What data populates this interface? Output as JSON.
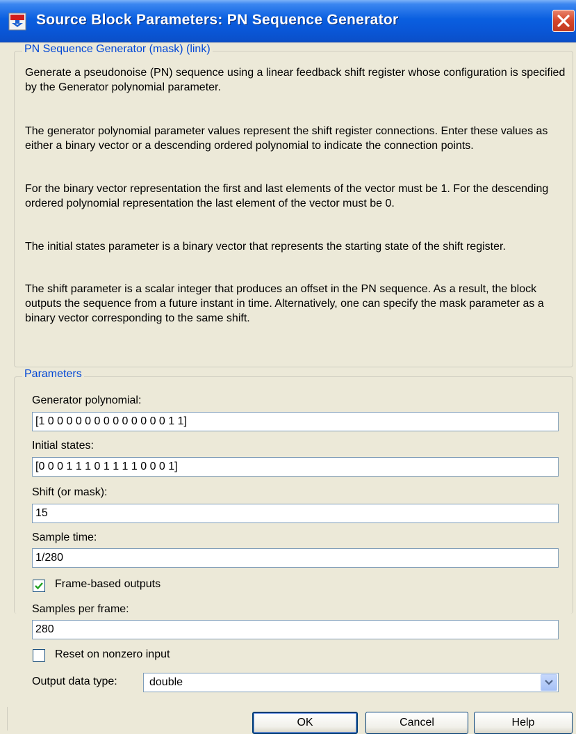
{
  "window": {
    "title": "Source Block Parameters: PN Sequence Generator",
    "app_icon": "simulink-block-icon",
    "close_icon": "close-icon"
  },
  "description": {
    "legend": "PN Sequence Generator (mask) (link)",
    "paragraphs": [
      "Generate a pseudonoise (PN) sequence using a linear feedback shift register whose configuration is specified by the Generator polynomial parameter.",
      "The generator polynomial parameter values represent the shift register connections. Enter these values as either a binary vector or a descending ordered polynomial to indicate the connection points.",
      "For the binary vector representation the first and last elements of the vector must be 1. For the descending ordered polynomial representation the last element of the vector must be 0.",
      "The initial states parameter is a binary vector that represents the starting state of the shift register.",
      "The shift parameter is a scalar integer that produces an offset in the PN sequence. As a result, the block outputs the sequence from a future instant in time. Alternatively, one can specify the mask parameter as a binary vector corresponding to the same shift."
    ]
  },
  "parameters": {
    "legend": "Parameters",
    "generator_polynomial": {
      "label": "Generator polynomial:",
      "value": "[1 0 0 0 0 0 0 0 0 0 0 0 0 0 1 1]"
    },
    "initial_states": {
      "label": "Initial states:",
      "value": "[0 0 0 1 1 1 0 1 1 1 1 0 0 0 1]"
    },
    "shift": {
      "label": "Shift (or mask):",
      "value": "15"
    },
    "sample_time": {
      "label": "Sample time:",
      "value": "1/280"
    },
    "frame_based": {
      "label": "Frame-based outputs",
      "checked": true
    },
    "samples_per_frame": {
      "label": "Samples per frame:",
      "value": "280"
    },
    "reset_nonzero": {
      "label": "Reset on nonzero input",
      "checked": false
    },
    "output_data_type": {
      "label": "Output data type:",
      "value": "double"
    }
  },
  "buttons": {
    "ok": "OK",
    "cancel": "Cancel",
    "help": "Help"
  },
  "colors": {
    "titlebar": "#0a56d6",
    "legend_text": "#0046d5",
    "dialog_bg": "#ece9d8",
    "check": "#21a121"
  }
}
